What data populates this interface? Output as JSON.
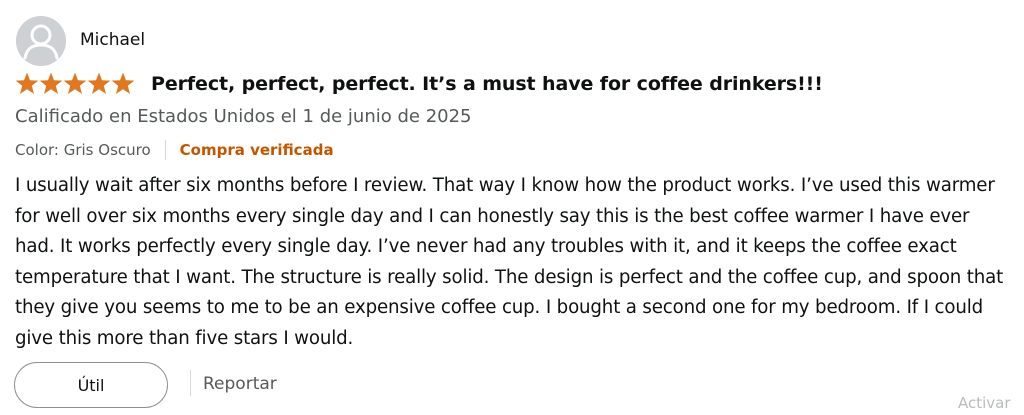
{
  "reviewer": {
    "name": "Michael",
    "avatar_icon": "default-user-avatar"
  },
  "rating": {
    "stars": 5,
    "max": 5,
    "color": "#de7921"
  },
  "review": {
    "title": "Perfect, perfect, perfect. It’s a must have for coffee drinkers!!!",
    "date_line": "Calificado en Estados Unidos el 1 de junio de 2025",
    "variant": "Color: Gris Oscuro",
    "verified_label": "Compra verificada",
    "body": "I usually wait after six months before I review. That way I know how the product works. I’ve used this warmer for well over six months every single day and I can honestly say this is the best coffee warmer I have ever had. It works perfectly every single day. I’ve never had any troubles with it, and it keeps the coffee exact temperature that I want. The structure is really solid. The design is perfect and the coffee cup, and spoon that they give you seems to me to be an expensive coffee cup. I bought a second one for my bedroom. If I could give this more than five stars I would."
  },
  "actions": {
    "helpful_label": "Útil",
    "report_label": "Reportar"
  },
  "overlay": {
    "watermark_text": "Activar"
  },
  "colors": {
    "verified": "#c45500",
    "secondary_text": "#565959",
    "star": "#de7921"
  }
}
